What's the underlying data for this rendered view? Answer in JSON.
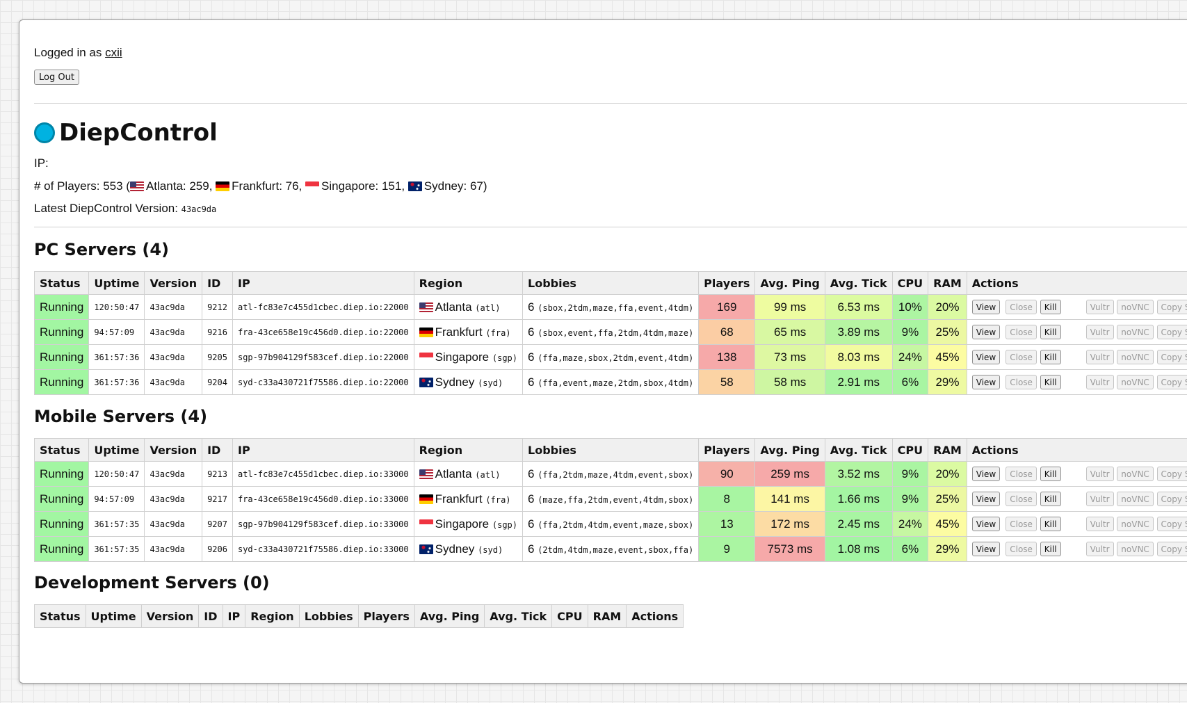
{
  "header": {
    "logged_in_prefix": "Logged in as ",
    "username": "cxii",
    "logout_label": "Log Out"
  },
  "title": "DiepControl",
  "info": {
    "ip_label": "IP:",
    "players_prefix": "# of Players: 553 (",
    "players_atl": "Atlanta: 259,",
    "players_fra": "Frankfurt: 76,",
    "players_sgp": "Singapore: 151,",
    "players_syd": "Sydney: 67)",
    "version_label": "Latest DiepControl Version: ",
    "version_value": "43ac9da"
  },
  "columns": [
    "Status",
    "Uptime",
    "Version",
    "ID",
    "IP",
    "Region",
    "Lobbies",
    "Players",
    "Avg. Ping",
    "Avg. Tick",
    "CPU",
    "RAM",
    "Actions"
  ],
  "action_labels": [
    "View",
    "Close",
    "Kill",
    "Vultr",
    "noVNC",
    "Copy SSH"
  ],
  "sections": [
    {
      "heading": "PC Servers (4)",
      "rows": [
        {
          "status": "Running",
          "uptime": "120:50:47",
          "version": "43ac9da",
          "id": "9212",
          "ip": "atl-fc83e7c455d1cbec.diep.io:22000",
          "flag": "us",
          "region": "Atlanta",
          "region_code": "(atl)",
          "lobbies_count": "6",
          "lobbies": "(sbox,2tdm,maze,ffa,event,4tdm)",
          "players": "169",
          "players_color": "#f6a9a9",
          "ping": "99 ms",
          "ping_color": "#eefca0",
          "tick": "6.53 ms",
          "tick_color": "#dcfba0",
          "cpu": "10%",
          "cpu_color": "#adf5a2",
          "ram": "20%",
          "ram_color": "#dbfaa2"
        },
        {
          "status": "Running",
          "uptime": "94:57:09",
          "version": "43ac9da",
          "id": "9216",
          "ip": "fra-43ce658e19c456d0.diep.io:22000",
          "flag": "de",
          "region": "Frankfurt",
          "region_code": "(fra)",
          "lobbies_count": "6",
          "lobbies": "(sbox,event,ffa,2tdm,4tdm,maze)",
          "players": "68",
          "players_color": "#fbcda4",
          "ping": "65 ms",
          "ping_color": "#d8f8a2",
          "tick": "3.89 ms",
          "tick_color": "#b6f5a2",
          "cpu": "9%",
          "cpu_color": "#aaf5a2",
          "ram": "25%",
          "ram_color": "#ecf8a2"
        },
        {
          "status": "Running",
          "uptime": "361:57:36",
          "version": "43ac9da",
          "id": "9205",
          "ip": "sgp-97b904129f583cef.diep.io:22000",
          "flag": "sg",
          "region": "Singapore",
          "region_code": "(sgp)",
          "lobbies_count": "6",
          "lobbies": "(ffa,maze,sbox,2tdm,event,4tdm)",
          "players": "138",
          "players_color": "#f6a9a9",
          "ping": "73 ms",
          "ping_color": "#def8a2",
          "tick": "8.03 ms",
          "tick_color": "#f2fba0",
          "cpu": "24%",
          "cpu_color": "#c6f7a2",
          "ram": "45%",
          "ram_color": "#fcfca2"
        },
        {
          "status": "Running",
          "uptime": "361:57:36",
          "version": "43ac9da",
          "id": "9204",
          "ip": "syd-c33a430721f75586.diep.io:22000",
          "flag": "au",
          "region": "Sydney",
          "region_code": "(syd)",
          "lobbies_count": "6",
          "lobbies": "(ffa,event,maze,2tdm,sbox,4tdm)",
          "players": "58",
          "players_color": "#fbd3a4",
          "ping": "58 ms",
          "ping_color": "#cef6a2",
          "tick": "2.91 ms",
          "tick_color": "#abf5a2",
          "cpu": "6%",
          "cpu_color": "#a8f5a2",
          "ram": "29%",
          "ram_color": "#eefaa2"
        }
      ]
    },
    {
      "heading": "Mobile Servers (4)",
      "rows": [
        {
          "status": "Running",
          "uptime": "120:50:47",
          "version": "43ac9da",
          "id": "9213",
          "ip": "atl-fc83e7c455d1cbec.diep.io:33000",
          "flag": "us",
          "region": "Atlanta",
          "region_code": "(atl)",
          "lobbies_count": "6",
          "lobbies": "(ffa,2tdm,maze,4tdm,event,sbox)",
          "players": "90",
          "players_color": "#f6b1a9",
          "ping": "259 ms",
          "ping_color": "#f6a9a9",
          "tick": "3.52 ms",
          "tick_color": "#b2f5a2",
          "cpu": "9%",
          "cpu_color": "#aaf5a2",
          "ram": "20%",
          "ram_color": "#dbfaa2"
        },
        {
          "status": "Running",
          "uptime": "94:57:09",
          "version": "43ac9da",
          "id": "9217",
          "ip": "fra-43ce658e19c456d0.diep.io:33000",
          "flag": "de",
          "region": "Frankfurt",
          "region_code": "(fra)",
          "lobbies_count": "6",
          "lobbies": "(maze,ffa,2tdm,event,4tdm,sbox)",
          "players": "8",
          "players_color": "#a8f5a2",
          "ping": "141 ms",
          "ping_color": "#fcf6a4",
          "tick": "1.66 ms",
          "tick_color": "#a4f5a2",
          "cpu": "9%",
          "cpu_color": "#aaf5a2",
          "ram": "25%",
          "ram_color": "#ecf8a2"
        },
        {
          "status": "Running",
          "uptime": "361:57:35",
          "version": "43ac9da",
          "id": "9207",
          "ip": "sgp-97b904129f583cef.diep.io:33000",
          "flag": "sg",
          "region": "Singapore",
          "region_code": "(sgp)",
          "lobbies_count": "6",
          "lobbies": "(ffa,2tdm,4tdm,event,maze,sbox)",
          "players": "13",
          "players_color": "#adf5a2",
          "ping": "172 ms",
          "ping_color": "#fcdca4",
          "tick": "2.45 ms",
          "tick_color": "#a8f5a2",
          "cpu": "24%",
          "cpu_color": "#c6f7a2",
          "ram": "45%",
          "ram_color": "#fcfca2"
        },
        {
          "status": "Running",
          "uptime": "361:57:35",
          "version": "43ac9da",
          "id": "9206",
          "ip": "syd-c33a430721f75586.diep.io:33000",
          "flag": "au",
          "region": "Sydney",
          "region_code": "(syd)",
          "lobbies_count": "6",
          "lobbies": "(2tdm,4tdm,maze,event,sbox,ffa)",
          "players": "9",
          "players_color": "#aaf5a2",
          "ping": "7573 ms",
          "ping_color": "#f6a9a9",
          "tick": "1.08 ms",
          "tick_color": "#a2f5a2",
          "cpu": "6%",
          "cpu_color": "#a8f5a2",
          "ram": "29%",
          "ram_color": "#eefaa2"
        }
      ]
    },
    {
      "heading": "Development Servers (0)",
      "rows": []
    }
  ]
}
